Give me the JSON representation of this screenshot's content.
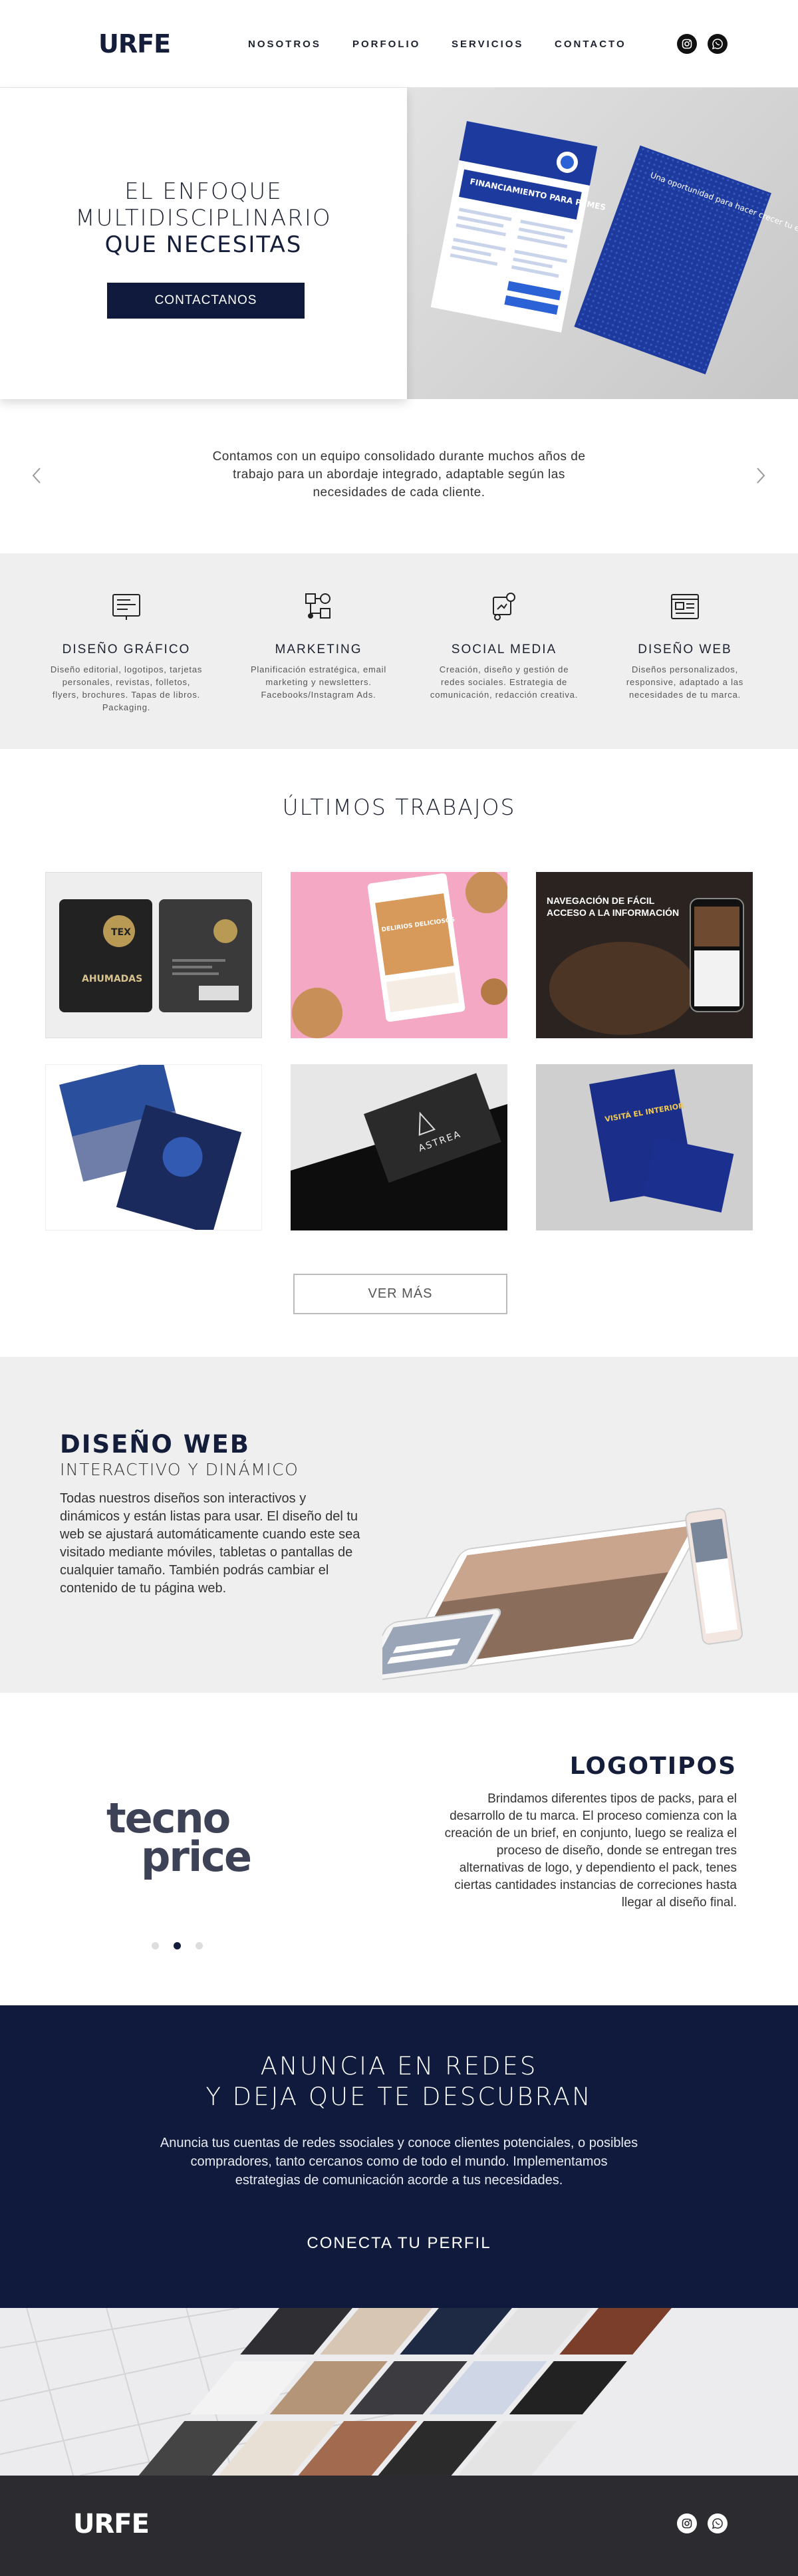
{
  "brand": {
    "logo_text": "URFE"
  },
  "nav": {
    "items": [
      "NOSOTROS",
      "PORFOLIO",
      "SERVICIOS",
      "CONTACTO"
    ]
  },
  "social": {
    "icons": [
      "instagram-icon",
      "whatsapp-icon"
    ]
  },
  "hero": {
    "title_line1": "EL ENFOQUE",
    "title_line2": "MULTIDISCIPLINARIO",
    "title_line3": "QUE NECESITAS",
    "cta_label": "CONTACTANOS",
    "flyer_front_title": "FINANCIAMIENTO PARA PYMES",
    "flyer_back_title": "Una oportunidad para hacer crecer tu empresa"
  },
  "about": {
    "text": "Contamos con un equipo consolidado durante muchos años de trabajo para un abordaje integrado, adaptable según las necesidades de cada cliente."
  },
  "services": [
    {
      "icon": "graphic-design-icon",
      "title": "DISEÑO GRÁFICO",
      "desc": "Diseño editorial, logotipos, tarjetas personales, revistas, folletos, flyers, brochures. Tapas de libros. Packaging."
    },
    {
      "icon": "marketing-icon",
      "title": "MARKETING",
      "desc": "Planificación estratégica, email marketing y newsletters. Facebooks/Instagram Ads."
    },
    {
      "icon": "social-media-icon",
      "title": "SOCIAL MEDIA",
      "desc": "Creación, diseño y gestión de redes sociales. Estrategia de comunicación, redacción creativa."
    },
    {
      "icon": "web-design-icon",
      "title": "DISEÑO WEB",
      "desc": "Diseños personalizados, responsive, adaptado a las necesidades de tu marca."
    }
  ],
  "works": {
    "title": "ÚLTIMOS TRABAJOS",
    "items": [
      {
        "name": "packaging-ahumada",
        "caption": "AHUMADAS",
        "badge": "TEX"
      },
      {
        "name": "instagram-cookies",
        "caption": "DELIRIOS DELICIOSOS"
      },
      {
        "name": "app-navegacion",
        "caption": "NAVEGACIÓN DE FÁCIL ACCESO A LA INFORMACIÓN"
      },
      {
        "name": "brochure-blue",
        "caption": ""
      },
      {
        "name": "business-card-astrea",
        "caption": "ASTREA"
      },
      {
        "name": "flyer-interior",
        "caption": "VISITÁ EL INTERIOR"
      }
    ],
    "more_label": "VER MÁS"
  },
  "webdesign": {
    "title": "DISEÑO WEB",
    "subtitle": "INTERACTIVO Y DINÁMICO",
    "text": "Todas nuestros diseños son interactivos y dinámicos y están listas para usar. El diseño del tu web se ajustará automáticamente cuando este sea visitado mediante móviles, tabletas o pantallas de cualquier tamaño. También podrás cambiar el contenido de tu página web."
  },
  "logotipos": {
    "title": "LOGOTIPOS",
    "text": "Brindamos diferentes tipos de packs, para el desarrollo de tu marca. El proceso comienza con la creación de un brief, en conjunto, luego se realiza el proceso de diseño, donde se entregan tres alternativas de logo, y dependiento el pack, tenes ciertas cantidades instancias de correciones hasta llegar al diseño final.",
    "example_line1": "tecno",
    "example_line2": "price",
    "active_dot": 2
  },
  "ads": {
    "title_line1": "ANUNCIA EN REDES",
    "title_line2": "Y DEJA QUE TE DESCUBRAN",
    "text": "Anuncia tus cuentas de redes ssociales y conoce clientes potenciales, o posibles compradores, tanto cercanos como de todo el mundo. Implementamos estrategias de comunicación acorde a tus necesidades.",
    "cta_label": "CONECTA TU PERFIL"
  },
  "footer": {
    "logo_text": "URFE"
  },
  "colors": {
    "navy": "#0f1a3d",
    "footer": "#2c2c30",
    "light_gray": "#f0eff0",
    "blue_print": "#1d3a9e"
  }
}
